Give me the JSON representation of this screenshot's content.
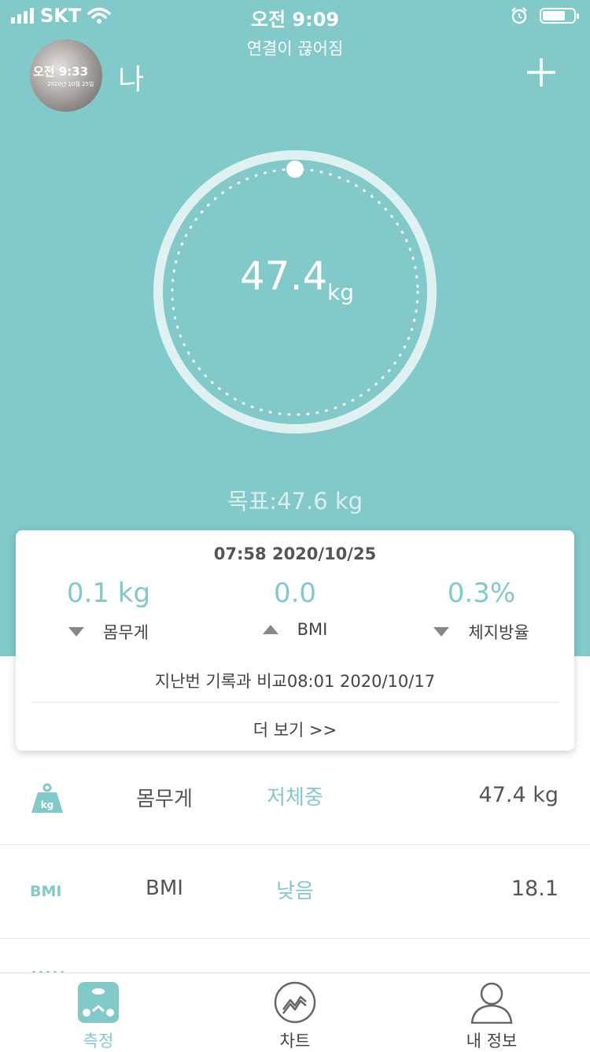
{
  "status_bar": {
    "carrier": "SKT",
    "time": "오전 9:09"
  },
  "header": {
    "connection_status": "연결이 끊어짐",
    "avatar_time": "오전 9:33",
    "avatar_caption": "2020년 10월 25일",
    "user_name": "나",
    "add_icon": "plus-icon"
  },
  "gauge": {
    "value": "47.4",
    "unit": "kg",
    "progress": 0
  },
  "goal": "목표:47.6 kg",
  "summary_card": {
    "datetime": "07:58 2020/10/25",
    "stats": [
      {
        "value": "0.1 kg",
        "label": "몸무게",
        "direction": "down"
      },
      {
        "value": "0.0",
        "label": "BMI",
        "direction": "up"
      },
      {
        "value": "0.3%",
        "label": "체지방율",
        "direction": "down"
      }
    ],
    "compare": "지난번 기록과 비교08:01 2020/10/17",
    "more": "더 보기 >>"
  },
  "metrics": [
    {
      "icon": "kg-weight-icon",
      "icon_text": "kg",
      "label": "몸무게",
      "status": "저체중",
      "value": "47.4 kg"
    },
    {
      "icon": "bmi-icon",
      "icon_text": "BMI",
      "label": "BMI",
      "status": "낮음",
      "value": "18.1"
    }
  ],
  "tabs": [
    {
      "label": "측정",
      "icon": "scale-icon",
      "active": true
    },
    {
      "label": "차트",
      "icon": "chart-icon",
      "active": false
    },
    {
      "label": "내 정보",
      "icon": "profile-icon",
      "active": false
    }
  ],
  "colors": {
    "accent": "#81cac9",
    "text": "#555555"
  }
}
